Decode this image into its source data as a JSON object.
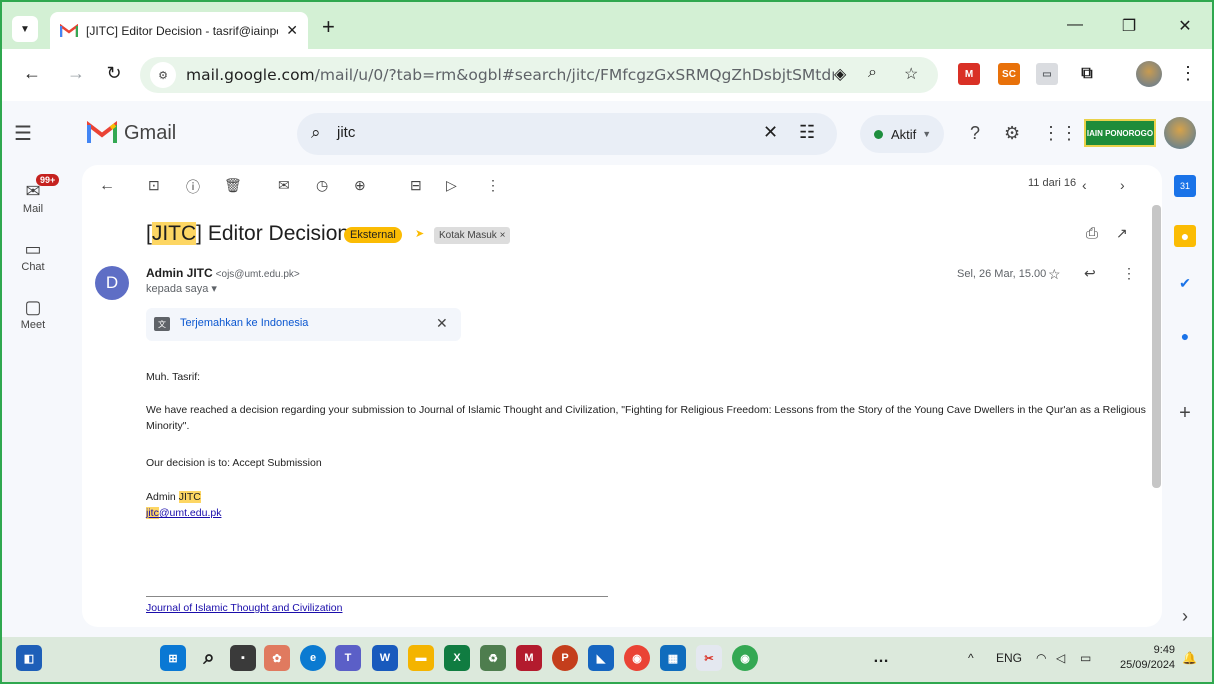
{
  "browser": {
    "tab_title": "[JITC] Editor Decision - tasrif@iainpon",
    "url_host": "mail.google.com",
    "url_path": "/mail/u/0/?tab=rm&ogbl#search/jitc/FMfcgzGxSRMQgZhDsbjtSMtdmZqK..."
  },
  "gmail": {
    "brand": "Gmail",
    "search_query": "jitc",
    "status": "Aktif",
    "org_logo": "IAIN PONOROGO",
    "rail": [
      {
        "label": "Mail",
        "icon": "mail-icon"
      },
      {
        "label": "Chat",
        "icon": "chat-icon"
      },
      {
        "label": "Meet",
        "icon": "meet-icon"
      }
    ],
    "badge": "99+"
  },
  "message": {
    "pager": "11 dari 16",
    "subject_prefix": "[",
    "subject_hl": "JITC",
    "subject_rest": "] Editor Decision",
    "label_external": "Eksternal",
    "label_inbox": "Kotak Masuk ×",
    "sender_initial": "D",
    "sender_name": "Admin JITC",
    "sender_email": "<ojs@umt.edu.pk>",
    "to": "kepada saya ▾",
    "date": "Sel, 26 Mar, 15.00",
    "translate": "Terjemahkan ke Indonesia",
    "greeting": "Muh. Tasrif:",
    "paragraph": "We have reached a decision regarding your submission to Journal of Islamic Thought and Civilization, \"Fighting for Religious Freedom: Lessons from the Story of the Young Cave Dwellers in the Qur'an as a Religious Minority\".",
    "decision": "Our decision is to: Accept Submission",
    "sig_name_prefix": "Admin ",
    "sig_name_hl": "JITC",
    "sig_email_hl": "jitc",
    "sig_email_rest": "@umt.edu.pk",
    "journal_link": "Journal of Islamic Thought and Civilization"
  },
  "taskbar": {
    "lang": "ENG",
    "time": "9:49",
    "date": "25/09/2024"
  },
  "colors": {
    "frame": "#2fa84f",
    "titlebar": "#d3f0d4",
    "highlight": "#fdd663",
    "external": "#fbbc04"
  }
}
